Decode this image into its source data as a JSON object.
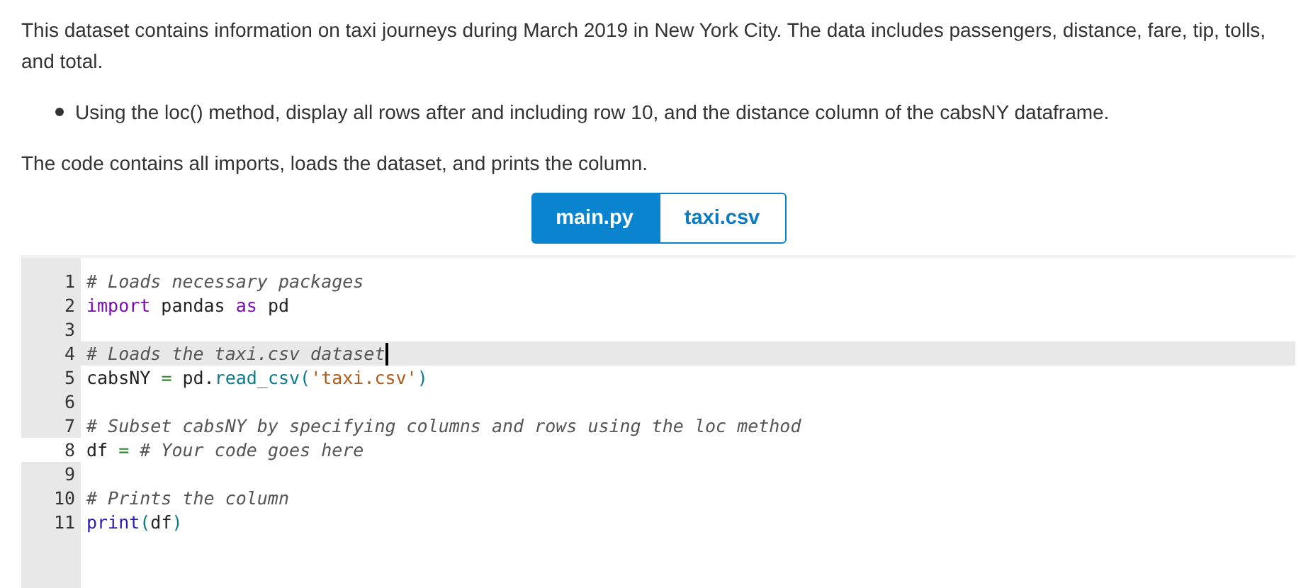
{
  "intro": "This dataset contains information on taxi journeys during March 2019 in New York City. The data includes passengers, distance, fare, tip, tolls, and total.",
  "bullets": [
    "Using the loc() method, display all rows after and including row 10, and the distance column of the cabsNY dataframe."
  ],
  "note": "The code contains all imports, loads the dataset, and prints the column.",
  "file_tabs": [
    {
      "label": "main.py",
      "selected": true
    },
    {
      "label": "taxi.csv",
      "selected": false
    }
  ],
  "editor": {
    "lines": [
      {
        "number": "1",
        "active": false,
        "gutter_marked": false,
        "tokens": [
          {
            "kind": "comment",
            "text": "# Loads necessary packages"
          }
        ]
      },
      {
        "number": "2",
        "active": false,
        "gutter_marked": false,
        "tokens": [
          {
            "kind": "keyword",
            "text": "import"
          },
          {
            "kind": "plain",
            "text": " pandas "
          },
          {
            "kind": "keyword",
            "text": "as"
          },
          {
            "kind": "plain",
            "text": " pd"
          }
        ]
      },
      {
        "number": "3",
        "active": false,
        "gutter_marked": false
      },
      {
        "number": "4",
        "active": true,
        "gutter_marked": false,
        "tokens": [
          {
            "kind": "comment",
            "text": "# Loads the taxi.csv dataset"
          }
        ]
      },
      {
        "number": "5",
        "active": false,
        "gutter_marked": false,
        "tokens": [
          {
            "kind": "plain",
            "text": "cabsNY "
          },
          {
            "kind": "operator",
            "text": "="
          },
          {
            "kind": "plain",
            "text": " pd."
          },
          {
            "kind": "func",
            "text": "read_csv("
          },
          {
            "kind": "string",
            "text": "'taxi.csv'"
          },
          {
            "kind": "func",
            "text": ")"
          }
        ]
      },
      {
        "number": "6",
        "active": false,
        "gutter_marked": false
      },
      {
        "number": "7",
        "active": false,
        "gutter_marked": false,
        "tokens": [
          {
            "kind": "comment",
            "text": "# Subset cabsNY by specifying columns and rows using the loc method"
          }
        ]
      },
      {
        "number": "8",
        "active": false,
        "gutter_marked": true,
        "tokens": [
          {
            "kind": "plain",
            "text": "df "
          },
          {
            "kind": "operator",
            "text": "="
          },
          {
            "kind": "comment",
            "text": " # Your code goes here"
          }
        ]
      },
      {
        "number": "9",
        "active": false,
        "gutter_marked": false
      },
      {
        "number": "10",
        "active": false,
        "gutter_marked": false,
        "tokens": [
          {
            "kind": "comment",
            "text": "# Prints the column"
          }
        ]
      },
      {
        "number": "11",
        "active": false,
        "gutter_marked": false,
        "tokens": [
          {
            "kind": "builtin",
            "text": "print"
          },
          {
            "kind": "func",
            "text": "("
          },
          {
            "kind": "plain",
            "text": "df"
          },
          {
            "kind": "func",
            "text": ")"
          }
        ]
      }
    ]
  }
}
